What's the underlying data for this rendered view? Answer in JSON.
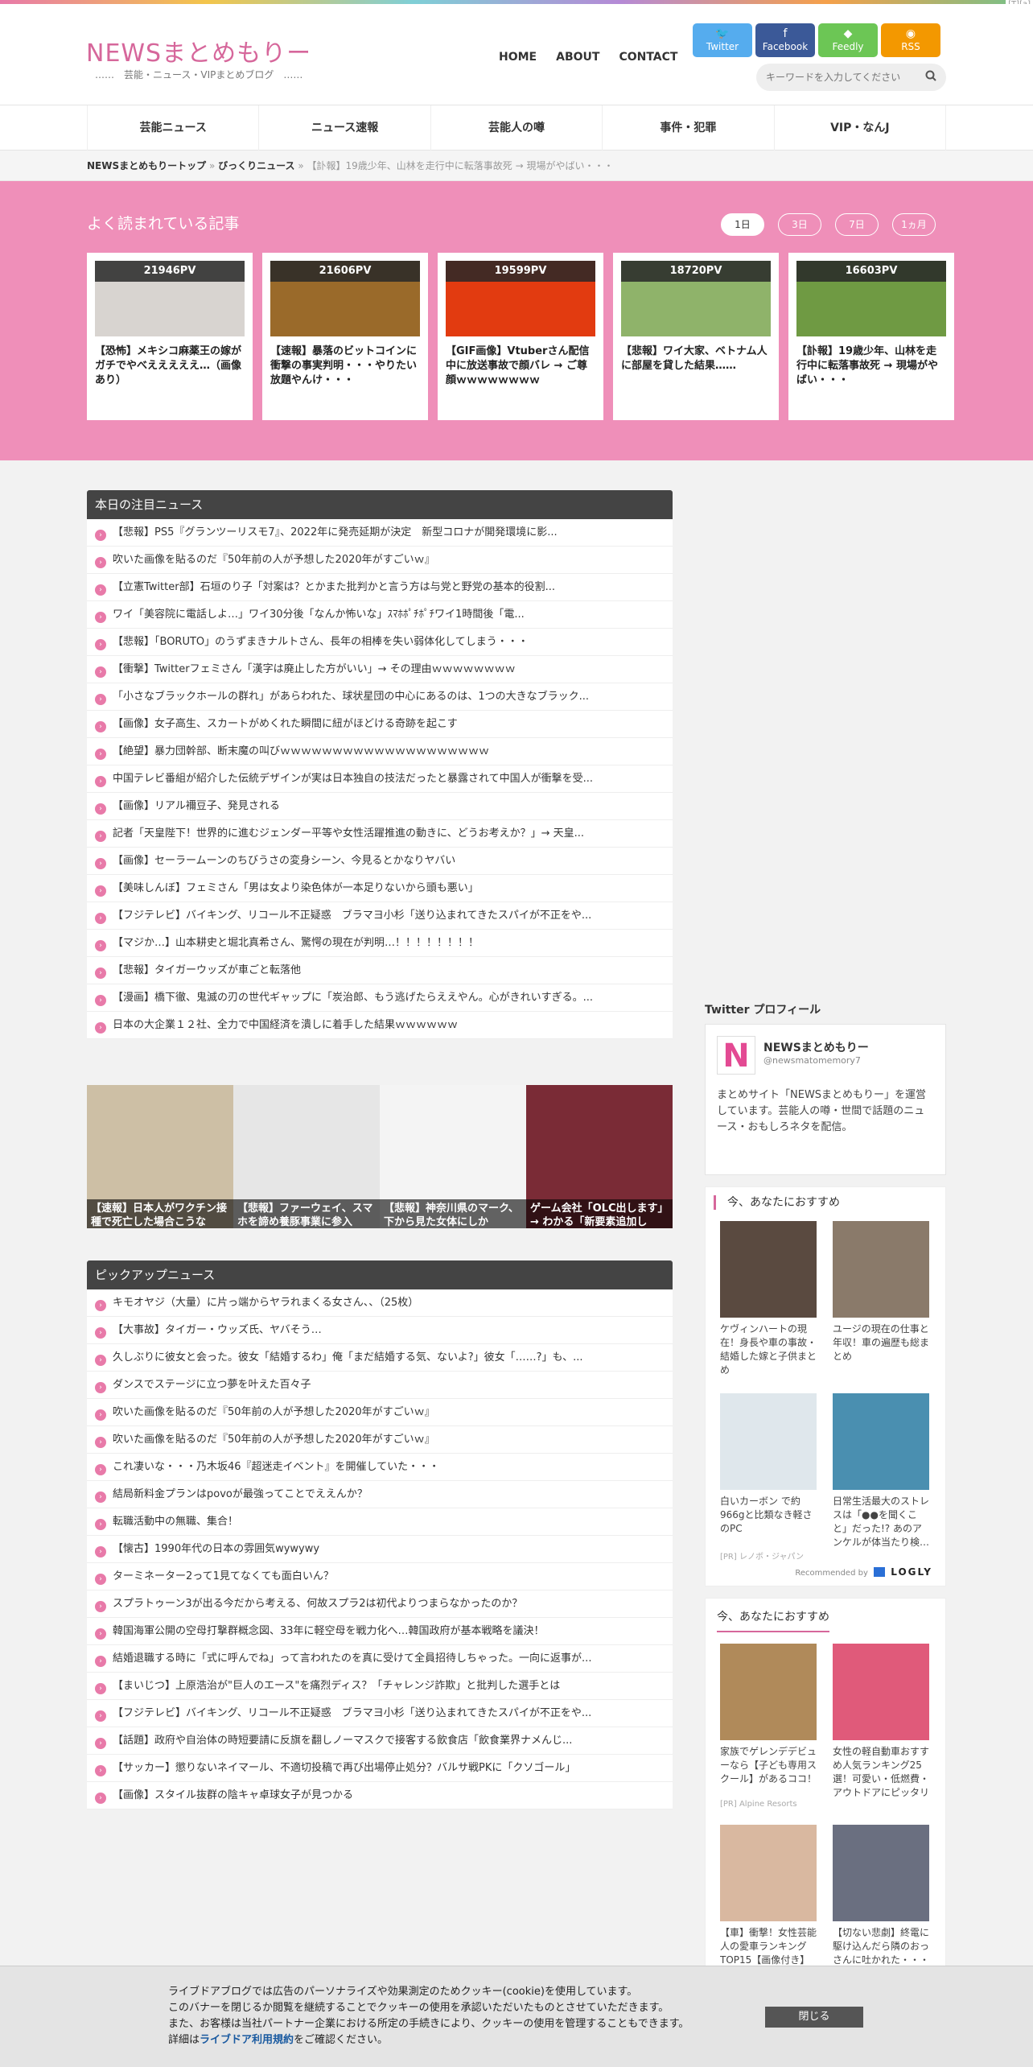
{
  "site": {
    "logo": "NEWSまとめもりー",
    "tagline": "……　芸能・ニュース・VIPまとめブログ　……",
    "corner_tag": "[T][a]"
  },
  "topnav": [
    "HOME",
    "ABOUT",
    "CONTACT"
  ],
  "social": [
    {
      "label": "Twitter",
      "icon": "twitter-icon",
      "glyph": "🐦",
      "color": "#55acee"
    },
    {
      "label": "Facebook",
      "icon": "facebook-icon",
      "glyph": "f",
      "color": "#3b5998"
    },
    {
      "label": "Feedly",
      "icon": "feedly-icon",
      "glyph": "◆",
      "color": "#6cc655"
    },
    {
      "label": "RSS",
      "icon": "rss-icon",
      "glyph": "◉",
      "color": "#f39800"
    }
  ],
  "search": {
    "placeholder": "キーワードを入力してください"
  },
  "categories": [
    "芸能ニュース",
    "ニュース速報",
    "芸能人の噂",
    "事件・犯罪",
    "VIP・なんJ"
  ],
  "breadcrumb": {
    "home": "NEWSまとめもりートップ",
    "sep": "»",
    "section": "びっくりニュース",
    "current": "【訃報】19歳少年、山林を走行中に転落事故死 → 現場がやばい・・・"
  },
  "popular": {
    "title": "よく読まれている記事",
    "ranges": [
      "1日",
      "3日",
      "7日",
      "1ヵ月"
    ],
    "cards": [
      {
        "pv": "21946PV",
        "title": "【恐怖】メキシコ麻薬王の嫁がガチでやべえええええ…（画像あり）",
        "bg": "#d8d4d0"
      },
      {
        "pv": "21606PV",
        "title": "【速報】暴落のビットコインに衝撃の事実判明・・・やりたい放題やんけ・・・",
        "bg": "#9a6a2a"
      },
      {
        "pv": "19599PV",
        "title": "【GIF画像】Vtuberさん配信中に放送事故で顔バレ → ご尊顔ｗｗｗｗｗｗｗｗ",
        "bg": "#e23b10"
      },
      {
        "pv": "18720PV",
        "title": "【悲報】ワイ大家、ベトナム人に部屋を貸した結果……",
        "bg": "#8fb36a"
      },
      {
        "pv": "16603PV",
        "title": "【訃報】19歳少年、山林を走行中に転落事故死 → 現場がやばい・・・",
        "bg": "#6f9a43"
      }
    ]
  },
  "today": {
    "title": "本日の注目ニュース",
    "items": [
      "【悲報】PS5『グランツーリスモ7』、2022年に発売延期が決定　新型コロナが開発環境に影...",
      "吹いた画像を貼るのだ『50年前の人が予想した2020年がすごいｗ』",
      "【立憲Twitter部】石垣のり子「対案は？とかまた批判かと言う方は与党と野党の基本的役割...",
      "ワイ「美容院に電話しよ…」ワイ30分後「なんか怖いな」ｽﾏﾎﾎﾟﾁﾎﾟﾁワイ1時間後「電...",
      "【悲報】「BORUTO」のうずまきナルトさん、長年の相棒を失い弱体化してしまう・・・",
      "【衝撃】Twitterフェミさん「漢字は廃止した方がいい」→ その理由ｗｗｗｗｗｗｗｗ",
      "「小さなブラックホールの群れ」があらわれた、球状星団の中心にあるのは、1つの大きなブラック...",
      "【画像】女子高生、スカートがめくれた瞬間に紐がほどける奇跡を起こす",
      "【絶望】暴力団幹部、断末魔の叫びｗｗｗｗｗｗｗｗｗｗｗｗｗｗｗｗｗｗｗｗ",
      "中国テレビ番組が紹介した伝統デザインが実は日本独自の技法だったと暴露されて中国人が衝撃を受...",
      "【画像】リアル襧豆子、発見される",
      "記者「天皇陛下！世界的に進むジェンダー平等や女性活躍推進の動きに、どうお考えか？」→ 天皇...",
      "【画像】セーラームーンのちびうさの変身シーン、今見るとかなりヤバい",
      "【美味しんぼ】フェミさん「男は女より染色体が一本足りないから頭も悪い」",
      "【フジテレビ】バイキング、リコール不正疑惑　ブラマヨ小杉「送り込まれてきたスパイが不正をや...",
      "【マジか…】山本耕史と堀北真希さん、驚愕の現在が判明…！！！！！！！！",
      "【悲報】タイガーウッズが車ごと転落他",
      "【漫画】橋下徹、鬼滅の刃の世代ギャップに「炭治郎、もう逃げたらええやん。心がきれいすぎる。...",
      "日本の大企業１２社、全力で中国経済を潰しに着手した結果ｗｗｗｗｗｗ"
    ]
  },
  "tiles": [
    {
      "caption": "【速報】日本人がワクチン接種で死亡した場合こうな",
      "bg": "#cdbfa5"
    },
    {
      "caption": "【悲報】ファーウェイ、スマホを諦め養豚事業に参入",
      "bg": "#e6e6e6"
    },
    {
      "caption": "【悲報】神奈川県のマーク、下から見た女体にしか",
      "bg": "#f4f4f4"
    },
    {
      "caption": "ゲーム会社「OLC出します」→ わかる「新要素追加し",
      "bg": "#7a2b36"
    }
  ],
  "pickup": {
    "title": "ピックアップニュース",
    "items": [
      "キモオヤジ（大量）に片っ端からヤラれまくる女さん、、（25枚）",
      "【大事故】タイガー・ウッズ氏、ヤバそう…",
      "久しぶりに彼女と会った。彼女「結婚するわ」俺「まだ結婚する気、ないよ?」彼女「……?」も、...",
      "ダンスでステージに立つ夢を叶えた百々子",
      "吹いた画像を貼るのだ『50年前の人が予想した2020年がすごいｗ』",
      "吹いた画像を貼るのだ『50年前の人が予想した2020年がすごいｗ』",
      "これ凄いな・・・乃木坂46『超迷走イベント』を開催していた・・・",
      "結局新料金プランはpovoが最強ってことでええんか？",
      "転職活動中の無職、集合！",
      "【懐古】1990年代の日本の雰囲気wywywy",
      "ターミネーター2って1見てなくても面白いん？",
      "スプラトゥーン3が出る今だから考える、何故スプラ2は初代よりつまらなかったのか？",
      "韓国海軍公開の空母打撃群概念図、33年に軽空母を戦力化へ…韓国政府が基本戦略を議決！",
      "結婚退職する時に「式に呼んでね」って言われたのを真に受けて全員招待しちゃった。一向に返事が...",
      "【まいじつ】上原浩治が\"巨人のエース\"を痛烈ディス？「チャレンジ詐欺」と批判した選手とは",
      "【フジテレビ】バイキング、リコール不正疑惑　ブラマヨ小杉「送り込まれてきたスパイが不正をや...",
      "【話題】政府や自治体の時短要請に反旗を翻しノーマスクで接客する飲食店「飲食業界ナメんじ...",
      "【サッカー】懲りないネイマール、不適切投稿で再び出場停止処分？バルサ戦PKに「クソゴール」",
      "【画像】スタイル抜群の陰キャ卓球女子が見つかる"
    ]
  },
  "twitter_profile": {
    "heading": "Twitter プロフィール",
    "logo_letter": "N",
    "name": "NEWSまとめもりー",
    "handle": "@newsmatomemory7",
    "desc": "まとめサイト「NEWSまとめもりー」を運営しています。芸能人の噂・世間で話題のニュース・おもしろネタを配信。"
  },
  "rec1": {
    "heading": "今、あなたにおすすめ",
    "items": [
      {
        "title": "ケヴィンハートの現在！身長や車の事故・結婚した嫁と子供まとめ",
        "src": "",
        "bg": "#5a4a40"
      },
      {
        "title": "ユージの現在の仕事と年収！車の遍歴も総まとめ",
        "src": "",
        "bg": "#8a7a6a"
      },
      {
        "title": "白いカーボン で約966gと比類なき軽さのPC",
        "src": "[PR] レノボ・ジャパン",
        "bg": "#dfe7ec"
      },
      {
        "title": "日常生活最大のストレスは「●●を聞くこと」だった!? あのアンケルが体当たり検…",
        "src": "",
        "bg": "#4a8fb0"
      }
    ],
    "recommended_by": "Recommended by",
    "logly": "LOGLY"
  },
  "rec2": {
    "heading": "今、あなたにおすすめ",
    "items": [
      {
        "title": "家族でゲレンデデビューなら【子ども専用スクール】があるココ！",
        "src": "[PR] Alpine Resorts",
        "bg": "#b08a5a"
      },
      {
        "title": "女性の軽自動車おすすめ人気ランキング25選！可愛い・低燃費・アウトドアにピッタリ",
        "src": "",
        "bg": "#e05a7a"
      },
      {
        "title": "【車】衝撃！女性芸能人の愛車ランキングTOP15【画像付き】",
        "src": "",
        "bg": "#d9b8a0"
      },
      {
        "title": "【切ない悲劇】終電に駆け込んだら隣のおっさんに吐かれた・・・",
        "src": "",
        "bg": "#6a6f80"
      }
    ]
  },
  "cookie": {
    "line1": "ライブドアブログでは広告のパーソナライズや効果測定のためクッキー(cookie)を使用しています。",
    "line2": "このバナーを閉じるか閲覧を継続することでクッキーの使用を承認いただいたものとさせていただきます。",
    "line3": "また、お客様は当社パートナー企業における所定の手続きにより、クッキーの使用を管理することもできます。",
    "line4_pre": "詳細は",
    "line4_link": "ライブドア利用規約",
    "line4_post": "をご確認ください。",
    "close": "閉じる"
  }
}
